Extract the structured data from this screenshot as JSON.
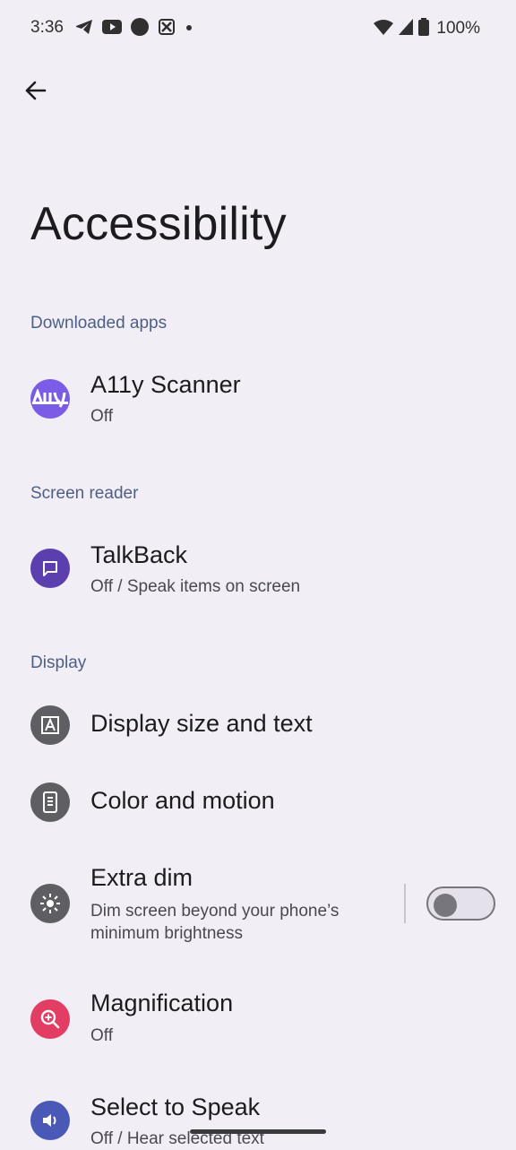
{
  "status_bar": {
    "time": "3:36",
    "battery": "100%",
    "notification_icons": [
      "telegram-icon",
      "youtube-icon",
      "circle-app-icon",
      "crossed-app-icon",
      "dot-icon"
    ],
    "system_icons": [
      "wifi-icon",
      "signal-icon",
      "battery-icon"
    ]
  },
  "header": {
    "back_icon": "arrow-left-icon",
    "title": "Accessibility"
  },
  "sections": {
    "downloaded_apps": {
      "label": "Downloaded apps",
      "items": [
        {
          "title": "A11y Scanner",
          "summary": "Off",
          "icon": "a11y-scanner-icon",
          "icon_color": "#7b5ce6"
        }
      ]
    },
    "screen_reader": {
      "label": "Screen reader",
      "items": [
        {
          "title": "TalkBack",
          "summary": "Off / Speak items on screen",
          "icon": "chat-bubble-icon",
          "icon_color": "#5b3fae"
        }
      ]
    },
    "display": {
      "label": "Display",
      "items": [
        {
          "title": "Display size and text",
          "icon": "text-size-icon",
          "icon_color": "#5f5f63"
        },
        {
          "title": "Color and motion",
          "icon": "phone-screen-icon",
          "icon_color": "#5f5f63"
        },
        {
          "title": "Extra dim",
          "summary_line1": "Dim screen beyond your phone’s",
          "summary_line2": "minimum brightness",
          "icon": "brightness-icon",
          "icon_color": "#5f5f63",
          "toggle_on": false
        },
        {
          "title": "Magnification",
          "summary": "Off",
          "icon": "zoom-in-icon",
          "icon_color": "#e43d64"
        },
        {
          "title": "Select to Speak",
          "summary": "Off / Hear selected text",
          "icon": "speaker-icon",
          "icon_color": "#4a59b5"
        }
      ]
    }
  },
  "colors": {
    "background": "#f1eef6",
    "section_header": "#4e5f85",
    "title_text": "#1c1b1f",
    "summary_text": "#4a4850"
  }
}
